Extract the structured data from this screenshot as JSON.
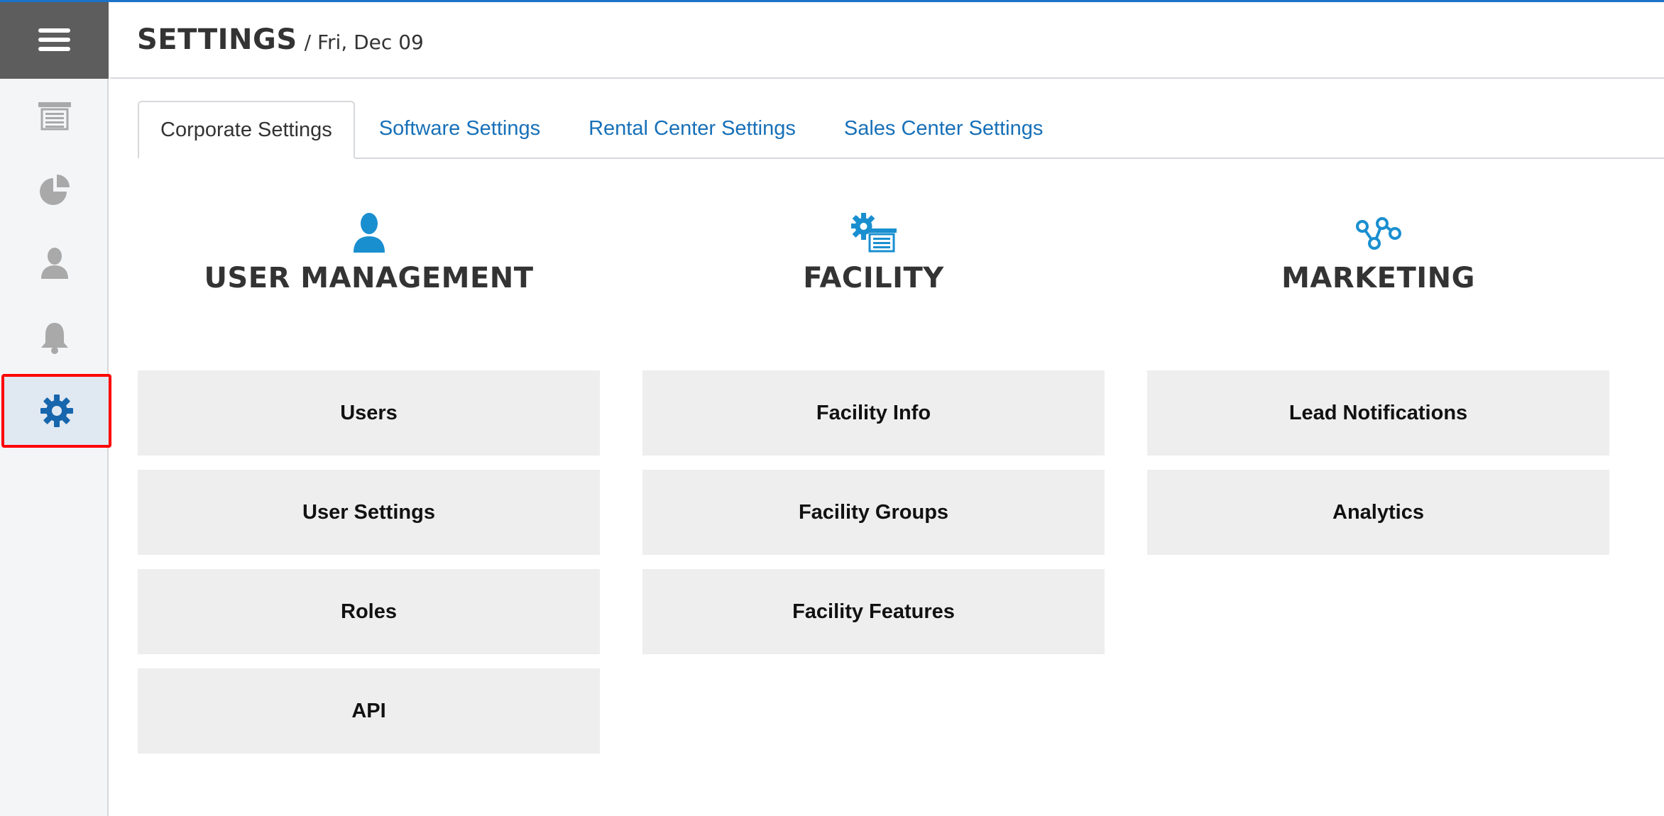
{
  "header": {
    "title": "SETTINGS",
    "date": "/ Fri, Dec 09"
  },
  "sidebar": {
    "items": [
      {
        "icon": "units-icon"
      },
      {
        "icon": "pie-chart-icon"
      },
      {
        "icon": "user-icon"
      },
      {
        "icon": "bell-icon"
      },
      {
        "icon": "gear-icon",
        "active": true
      }
    ]
  },
  "tabs": [
    {
      "label": "Corporate Settings",
      "active": true
    },
    {
      "label": "Software Settings"
    },
    {
      "label": "Rental Center Settings"
    },
    {
      "label": "Sales Center Settings"
    }
  ],
  "sections": {
    "user_management": {
      "title": "USER MANAGEMENT",
      "icon": "user-icon",
      "buttons": [
        "Users",
        "User Settings",
        "Roles",
        "API"
      ]
    },
    "facility": {
      "title": "FACILITY",
      "icon": "facility-gear-icon",
      "buttons": [
        "Facility Info",
        "Facility Groups",
        "Facility Features"
      ]
    },
    "marketing": {
      "title": "MARKETING",
      "icon": "network-icon",
      "buttons": [
        "Lead Notifications",
        "Analytics"
      ]
    }
  },
  "colors": {
    "accent": "#1770b8",
    "icon_blue": "#1a8fd0",
    "sidebar_icon": "#a9a9a9",
    "active_icon": "#1766ad",
    "tile_bg": "#eeeeee",
    "highlight_border": "#ff0000"
  }
}
